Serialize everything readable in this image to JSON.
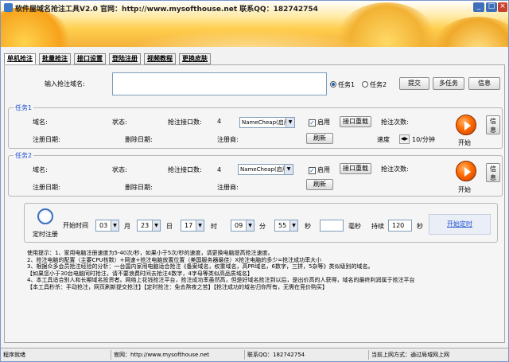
{
  "window": {
    "title": "软件屋域名抢注工具V2.0  官网：http://www.mysofthouse.net  联系QQ：182742754"
  },
  "tabs": [
    "单机抢注",
    "批量抢注",
    "接口设置",
    "登陆注册",
    "视频教程",
    "更换皮肤"
  ],
  "top": {
    "domain_label": "输入抢注域名:",
    "domain_value": "",
    "task1_radio": "任务1",
    "task2_radio": "任务2",
    "submit_label": "提交",
    "multitask_label": "多任务",
    "info_label": "信息"
  },
  "task1": {
    "title": "任务1",
    "domain_label": "域名:",
    "status_label": "状态:",
    "iface_count_label": "抢注接口数:",
    "iface_count": "4",
    "iface_select": "NameCheap(启用",
    "enable_label": "启用",
    "iface_reload_label": "接口重载",
    "attempts_label": "抢注次数:",
    "reg_date_label": "注册日期:",
    "del_date_label": "删除日期:",
    "registrar_label": "注册商:",
    "refresh_label": "刷新",
    "speed_label": "速度",
    "speed_value": "10/分钟",
    "start_label": "开始",
    "info_label": "信息"
  },
  "task2": {
    "title": "任务2",
    "domain_label": "域名:",
    "status_label": "状态:",
    "iface_count_label": "抢注接口数:",
    "iface_count": "4",
    "iface_select": "NameCheap(启用",
    "enable_label": "启用",
    "iface_reload_label": "接口重载",
    "attempts_label": "抢注次数:",
    "reg_date_label": "注册日期:",
    "del_date_label": "删除日期:",
    "registrar_label": "注册商:",
    "refresh_label": "刷新",
    "speed_label": "速度",
    "speed_value": "10/分钟",
    "start_label": "开始",
    "info_label": "信息"
  },
  "timer": {
    "label": "定时注册",
    "start_time_label": "开始时间",
    "month": "03",
    "month_unit": "月",
    "day": "23",
    "day_unit": "日",
    "hour": "17",
    "hour_unit": "时",
    "minute": "09",
    "minute_unit": "分",
    "second": "55",
    "second_unit": "秒",
    "ms_value": "",
    "ms_unit": "毫秒",
    "duration_label": "持续",
    "duration_value": "120",
    "duration_unit": "秒",
    "start_timer_label": "开始定时"
  },
  "tips": [
    "使用提示：1、家用电脑注册速度为5-40次/秒，如果小于5次/秒的速度，请更换电脑提高抢注速度。",
    "2、抢注电脑的配置（主要CPU核数）+网速+抢注电脑放置位置（美国服务器最佳）X抢注电脑的多少=抢注成功率大小",
    "3、根据众多会员抢注经验的分析：一台国内家用电脑适合抢注《备案域名，权重域名，高PR域名，6数字，三拼，5杂等》类似级别的域名。",
    "【如果您小于30台电脑同时抢注，请不要浪费时间去抢注4数字，4字母等类似高品质域名】",
    "4、本工具适合别人和长期域名投资者。网络上花钱抢注平台，抢注成功率虽然高，但是好域名抢注到以后，是出价高的人获得，域名的最终利润属于抢注平台",
    "【本工具秒杀：手动抢注，网页刷新提交抢注】【定时抢注：免去熬夜之苦】【抢注成功的域名归你所有，无需在竞价购买】"
  ],
  "status": {
    "ready": "程序就绪",
    "website": "官网：http://www.mysofthouse.net",
    "qq": "联系QQ：182742754",
    "mode": "当前上网方式：通过局域网上网"
  },
  "colors": {
    "group_title": "#1f4fd1",
    "start_timer_link": "#1f4fd1",
    "title_gradient_start": "#ffe9a3",
    "title_gradient_end": "#f4b13a",
    "play_button": "#ff6a00"
  }
}
